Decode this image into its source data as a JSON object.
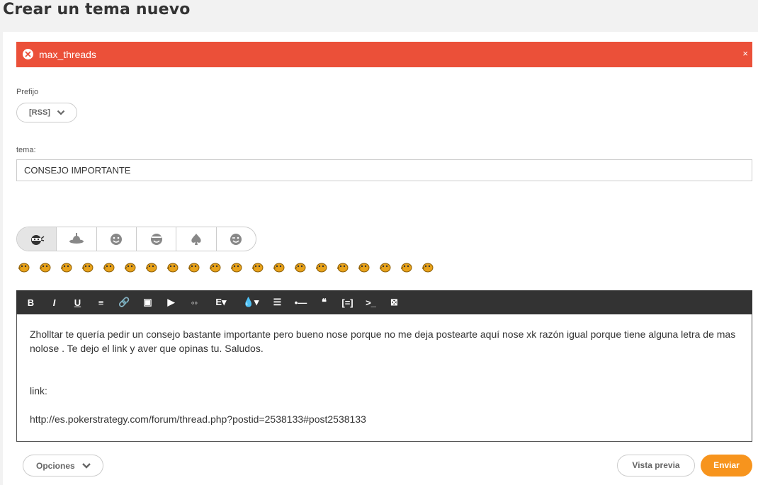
{
  "page": {
    "title": "Crear un tema nuevo"
  },
  "alert": {
    "message": "max_threads",
    "close": "×",
    "color": "#eb5039"
  },
  "prefix": {
    "label": "Prefijo",
    "value": "[RSS]"
  },
  "topic": {
    "label": "tema:",
    "value": "CONSEJO IMPORTANTE"
  },
  "smiley_tabs": [
    "ninja-smiley-icon",
    "pirate-smiley-icon",
    "smile-icon",
    "grin-icon",
    "spade-icon",
    "wink-icon"
  ],
  "smileys_count": 20,
  "toolbar": {
    "items": [
      {
        "label": "B",
        "icon": "bold-icon"
      },
      {
        "label": "I",
        "icon": "italic-icon"
      },
      {
        "label": "U",
        "icon": "underline-icon"
      },
      {
        "label": "≡",
        "icon": "align-center-icon"
      },
      {
        "label": "🔗",
        "icon": "link-icon"
      },
      {
        "label": "▣",
        "icon": "image-icon"
      },
      {
        "label": "▶",
        "icon": "youtube-icon"
      },
      {
        "label": "◦◦",
        "icon": "voicemail-icon"
      },
      {
        "label": "E▾",
        "icon": "font-size-icon"
      },
      {
        "label": "💧▾",
        "icon": "color-icon"
      },
      {
        "label": "☰",
        "icon": "list-icon"
      },
      {
        "label": "•—",
        "icon": "hr-icon"
      },
      {
        "label": "❝",
        "icon": "quote-icon"
      },
      {
        "label": "[=]",
        "icon": "code-icon"
      },
      {
        "label": ">_",
        "icon": "terminal-icon"
      },
      {
        "label": "⊠",
        "icon": "remove-format-icon"
      }
    ]
  },
  "editor": {
    "line1": "Zholltar te quería pedir un consejo bastante importante pero bueno nose porque no me deja postearte aquí nose xk razón igual porque tiene alguna letra de mas nolose . Te dejo el link y aver que opinas tu. Saludos.",
    "line2": "link:",
    "line3": "http://es.pokerstrategy.com/forum/thread.php?postid=2538133#post2538133"
  },
  "buttons": {
    "options": "Opciones",
    "preview": "Vista previa",
    "send": "Enviar",
    "accent": "#f7941d"
  }
}
